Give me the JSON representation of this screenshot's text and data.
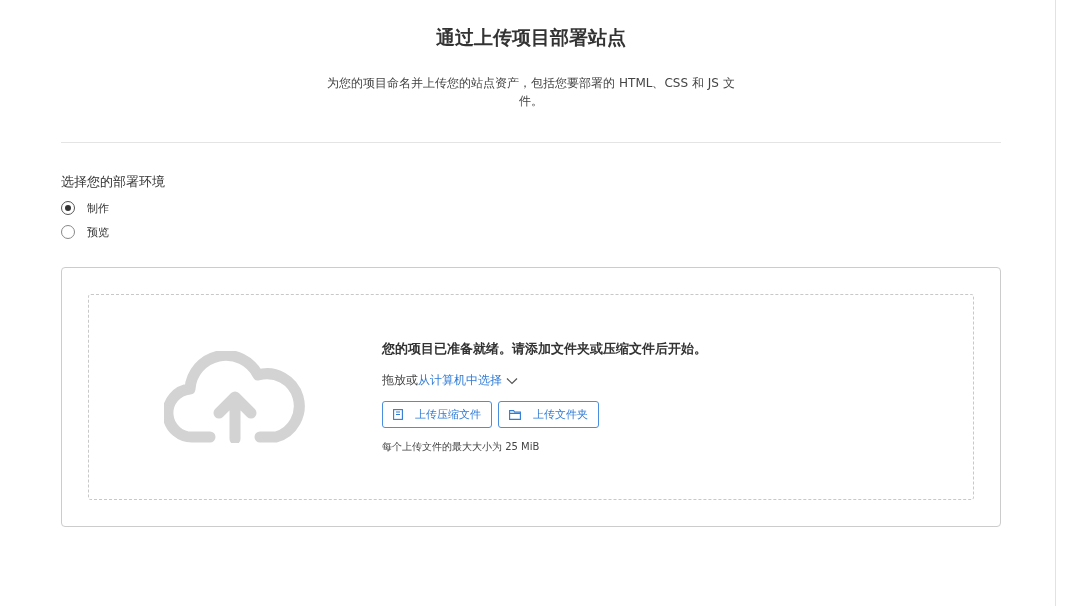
{
  "title": "通过上传项目部署站点",
  "subtitle": "为您的项目命名并上传您的站点资产，包括您要部署的 HTML、CSS 和 JS 文件。",
  "environment": {
    "label": "选择您的部署环境",
    "options": [
      {
        "label": "制作",
        "selected": true
      },
      {
        "label": "预览",
        "selected": false
      }
    ]
  },
  "upload": {
    "heading": "您的项目已准备就绪。请添加文件夹或压缩文件后开始。",
    "drop_prefix": "拖放或",
    "select_link": "从计算机中选择",
    "buttons": [
      {
        "kind": "zip",
        "label": "上传压缩文件"
      },
      {
        "kind": "folder",
        "label": "上传文件夹"
      }
    ],
    "limit_note": "每个上传文件的最大大小为 25 MiB"
  }
}
